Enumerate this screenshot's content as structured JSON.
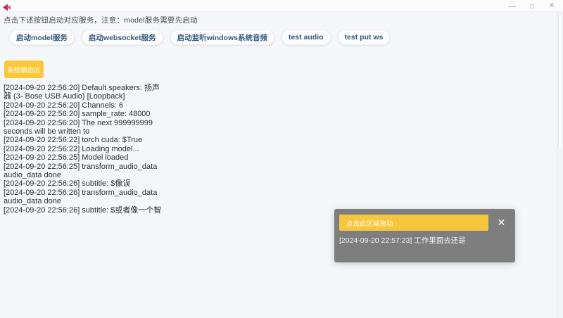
{
  "window": {
    "instruction": "点击下述按钮启动对应服务，注意：model服务需要先启动",
    "controls": {
      "minimize": "—",
      "maximize": "▢",
      "close": "✕"
    }
  },
  "toolbar": {
    "buttons": [
      "启动model服务",
      "启动websocket服务",
      "启动监听windows系统音频",
      "test audio",
      "test put ws"
    ]
  },
  "output": {
    "header": "系统输出区",
    "lines": [
      "[2024-09-20 22:56:20] Default speakers: 扬声",
      "器 (3- Bose USB Audio) [Loopback]",
      "[2024-09-20 22:56:20] Channels: 6",
      "[2024-09-20 22:56:20] sample_rate: 48000",
      "[2024-09-20 22:56:20] The next 999999999",
      "seconds will be written to",
      "[2024-09-20 22:56:22] torch cuda: $True",
      "[2024-09-20 22:56:22] Loading model...",
      "[2024-09-20 22:56:25] Model loaded",
      "[2024-09-20 22:56:25] transform_audio_data",
      "audio_data done",
      "[2024-09-20 22:56:26] subtitle: $像误",
      "[2024-09-20 22:56:26] transform_audio_data",
      "audio_data done",
      "[2024-09-20 22:56:26] subtitle: $或者像一个智"
    ]
  },
  "overlay": {
    "drag_label": "点击此区域拖动",
    "close": "✕",
    "line": "[2024-09-20 22:57:23] 工作里面去还是"
  },
  "colors": {
    "background": "#f5f7fb",
    "accent_yellow": "#fbc93a",
    "overlay_yellow": "#f6c63d",
    "button_text_blue": "#33587e",
    "panel_gray": "#7e7e7e",
    "app_icon_pink": "#e05c86",
    "app_icon_dark_pink": "#c2255c"
  }
}
